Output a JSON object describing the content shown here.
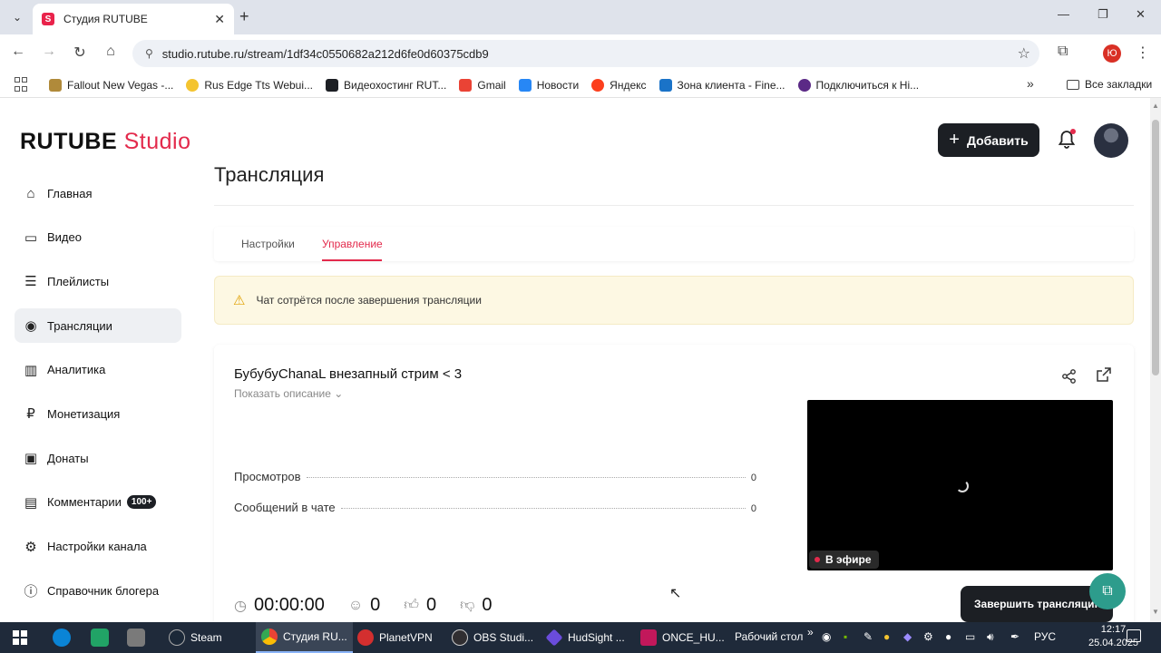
{
  "browser": {
    "tab_title": "Студия RUTUBE",
    "favicon_letter": "S",
    "url": "studio.rutube.ru/stream/1df34c0550682a212d6fe0d60375cdb9",
    "profile_letter": "Ю",
    "bookmarks": [
      {
        "label": "Fallout New Vegas -...",
        "color": "#b08a3a"
      },
      {
        "label": "Rus Edge Tts Webui...",
        "color": "#f4c430"
      },
      {
        "label": "Видеохостинг RUT...",
        "color": "#1c1f24"
      },
      {
        "label": "Gmail",
        "color": "#ea4335"
      },
      {
        "label": "Новости",
        "color": "#2787f5"
      },
      {
        "label": "Яндекс",
        "color": "#fc3f1d"
      },
      {
        "label": "Зона клиента - Fine...",
        "color": "#1a73c8"
      },
      {
        "label": "Подключиться к Hi...",
        "color": "#5b2a86"
      }
    ],
    "all_bookmarks": "Все закладки"
  },
  "header": {
    "logo_main": "RUTUBE",
    "logo_studio": "Studio",
    "add_label": "Добавить"
  },
  "sidebar": {
    "items": [
      {
        "label": "Главная",
        "icon": "home-icon",
        "glyph": "⌂"
      },
      {
        "label": "Видео",
        "icon": "video-icon",
        "glyph": "▭"
      },
      {
        "label": "Плейлисты",
        "icon": "playlist-icon",
        "glyph": "☰"
      },
      {
        "label": "Трансляции",
        "icon": "broadcast-icon",
        "glyph": "◉"
      },
      {
        "label": "Аналитика",
        "icon": "analytics-icon",
        "glyph": "▥"
      },
      {
        "label": "Монетизация",
        "icon": "ruble-icon",
        "glyph": "₽"
      },
      {
        "label": "Донаты",
        "icon": "wallet-icon",
        "glyph": "▣"
      },
      {
        "label": "Комментарии",
        "icon": "comments-icon",
        "glyph": "▤",
        "badge": "100+"
      },
      {
        "label": "Настройки канала",
        "icon": "gear-icon",
        "glyph": "⚙"
      },
      {
        "label": "Справочник блогера",
        "icon": "info-icon",
        "glyph": "ⓘ"
      }
    ]
  },
  "main": {
    "page_title": "Трансляция",
    "tabs": [
      {
        "label": "Настройки"
      },
      {
        "label": "Управление"
      }
    ],
    "warning": "Чат сотрётся после завершения трансляции",
    "stream": {
      "title": "БубубуChanaL внезапный стрим < 3",
      "show_description": "Показать описание",
      "stats": [
        {
          "label": "Просмотров",
          "value": "0"
        },
        {
          "label": "Сообщений в чате",
          "value": "0"
        }
      ],
      "live_label": "В эфире",
      "duration": "00:00:00",
      "viewers": "0",
      "likes": "0",
      "dislikes": "0"
    },
    "finish_label": "Завершить трансляцию"
  },
  "taskbar": {
    "apps": [
      {
        "label": "Steam",
        "color": "#1b2838"
      },
      {
        "label": "Студия RU...",
        "color": "#4285f4"
      },
      {
        "label": "PlanetVPN",
        "color": "#d32f2f"
      },
      {
        "label": "OBS Studi...",
        "color": "#302e31"
      },
      {
        "label": "HudSight ...",
        "color": "#6a4cdb"
      },
      {
        "label": "ONCE_HU...",
        "color": "#c2185b"
      }
    ],
    "desktop_label": "Рабочий стол",
    "lang": "РУС",
    "time": "12:17",
    "date": "25.04.2025"
  }
}
